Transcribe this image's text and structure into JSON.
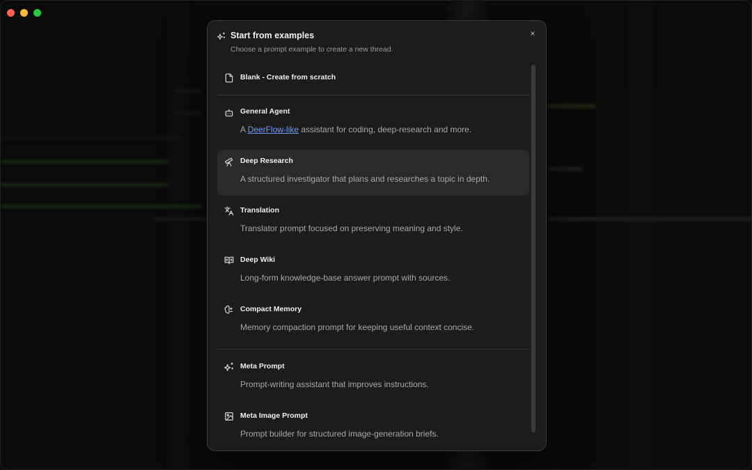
{
  "dialog": {
    "title": "Start from examples",
    "subtitle": "Choose a prompt example to create a new thread.",
    "close_label": "×",
    "title_icon": "sparkles-icon"
  },
  "items": [
    {
      "title": "Blank - Create from scratch",
      "desc": "",
      "icon": "file-icon"
    },
    {
      "title": "General Agent",
      "desc_prefix": "A ",
      "desc_link": "DeerFlow-like",
      "desc_suffix": " assistant for coding, deep-research and more.",
      "icon": "bot-icon"
    },
    {
      "title": "Deep Research",
      "desc": "A structured investigator that plans and researches a topic in depth.",
      "icon": "telescope-icon"
    },
    {
      "title": "Translation",
      "desc": "Translator prompt focused on preserving meaning and style.",
      "icon": "languages-icon"
    },
    {
      "title": "Deep Wiki",
      "desc": "Long-form knowledge-base answer prompt with sources.",
      "icon": "book-open-icon"
    },
    {
      "title": "Compact Memory",
      "desc": "Memory compaction prompt for keeping useful context concise.",
      "icon": "brain-icon"
    },
    {
      "title": "Meta Prompt",
      "desc": "Prompt-writing assistant that improves instructions.",
      "icon": "sparkles-icon"
    },
    {
      "title": "Meta Image Prompt",
      "desc": "Prompt builder for structured image-generation briefs.",
      "icon": "image-icon"
    }
  ],
  "colors": {
    "accent_link": "#6b9cff",
    "dialog_bg": "#1c1c1c",
    "active_row": "#2a2a2a"
  }
}
